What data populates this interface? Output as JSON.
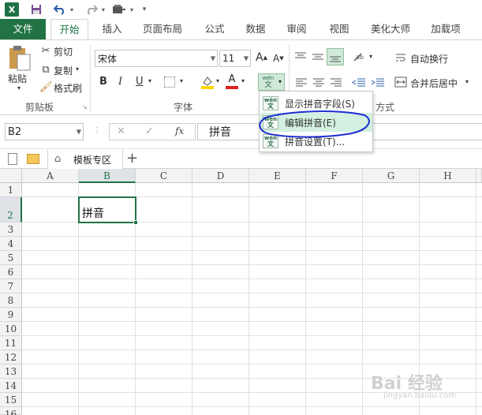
{
  "colors": {
    "brand": "#217346",
    "highlight": "#d3f0e0",
    "annotation": "#1a2fd1"
  },
  "qat": {
    "logo": "X",
    "icons": [
      "save-icon",
      "undo-icon",
      "redo-icon",
      "form-icon",
      "customize-icon"
    ]
  },
  "tabs": [
    "文件",
    "开始",
    "插入",
    "页面布局",
    "公式",
    "数据",
    "审阅",
    "视图",
    "美化大师",
    "加载项"
  ],
  "clipboard": {
    "paste": "粘贴",
    "cut": "剪切",
    "copy": "复制",
    "format_painter": "格式刷",
    "group": "剪贴板"
  },
  "font": {
    "name": "宋体",
    "size": "11",
    "grow": "A",
    "shrink": "A",
    "bold": "B",
    "italic": "I",
    "underline": "U",
    "font_color": "A",
    "phonetic_top": "wén",
    "phonetic_bottom": "文",
    "group": "字体"
  },
  "alignment": {
    "wrap": "自动换行",
    "merge": "合并后居中",
    "group_partial": "方式"
  },
  "formula_bar": {
    "name_box": "B2",
    "cancel": "✕",
    "enter": "✓",
    "fx": "fx",
    "content": "拼音"
  },
  "workbook_tabs": {
    "template_tab": "模板专区",
    "add": "+"
  },
  "grid": {
    "columns": [
      "A",
      "B",
      "C",
      "D",
      "E",
      "F",
      "G",
      "H"
    ],
    "rows": [
      "1",
      "2",
      "3",
      "4",
      "5",
      "6",
      "7",
      "8",
      "9",
      "10",
      "11",
      "12",
      "13",
      "14",
      "15",
      "16"
    ],
    "active_cell": "B2",
    "cell_B2": "拼音"
  },
  "menu": {
    "items": [
      {
        "icon_top": "wén",
        "icon_bottom": "文",
        "label": "显示拼音字段(S)"
      },
      {
        "icon_top": "wén",
        "icon_bottom": "文",
        "label": "编辑拼音(E)"
      },
      {
        "icon_top": "wén",
        "icon_bottom": "文",
        "label": "拼音设置(T)..."
      }
    ]
  },
  "watermark": {
    "text": "Bai 经验",
    "sub": "jingyan.baidu.com"
  }
}
